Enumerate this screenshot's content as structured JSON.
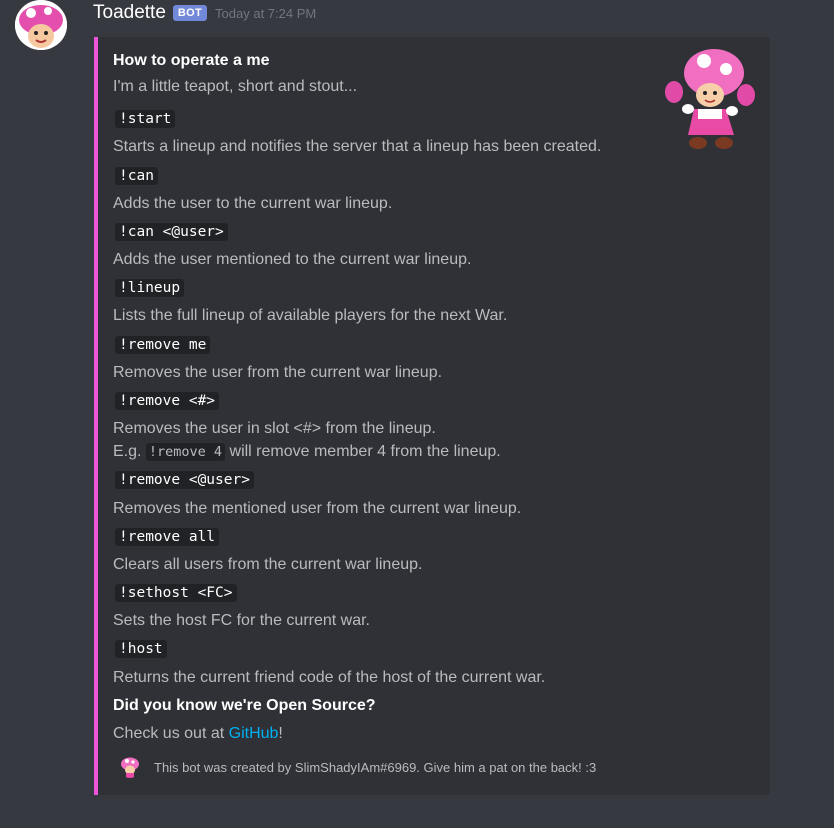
{
  "message": {
    "author": "Toadette",
    "bot_tag": "BOT",
    "timestamp": "Today at 7:24 PM"
  },
  "embed": {
    "accent_color": "#ee55d8",
    "title": "How to operate a me",
    "description": "I'm a little teapot, short and stout...",
    "commands": [
      {
        "cmd": "!start",
        "desc": "Starts a lineup and notifies the server that a lineup has been created."
      },
      {
        "cmd": "!can",
        "desc": "Adds the user to the current war lineup."
      },
      {
        "cmd": "!can <@user>",
        "desc": "Adds the user mentioned to the current war lineup."
      },
      {
        "cmd": "!lineup",
        "desc": "Lists the full lineup of available players for the next War."
      },
      {
        "cmd": "!remove me",
        "desc": "Removes the user from the current war lineup."
      },
      {
        "cmd": "!remove <#>",
        "desc": "Removes the user in slot <#> from the lineup.",
        "example_prefix": "E.g. ",
        "example_code": "!remove 4",
        "example_suffix": " will remove member 4 from the lineup."
      },
      {
        "cmd": "!remove <@user>",
        "desc": "Removes the mentioned user from the current war lineup."
      },
      {
        "cmd": "!remove all",
        "desc": "Clears all users from the current war lineup."
      },
      {
        "cmd": "!sethost <FC>",
        "desc": "Sets the host FC for the current war."
      },
      {
        "cmd": "!host",
        "desc": "Returns the current friend code of the host of the current war."
      }
    ],
    "open_source": {
      "name": "Did you know we're Open Source?",
      "text_prefix": "Check us out at ",
      "link": "GitHub",
      "text_suffix": "!"
    },
    "footer": "This bot was created by SlimShadyIAm#6969. Give him a pat on the back! :3"
  },
  "colors": {
    "background": "#36393f",
    "embed_bg": "#2f3136",
    "link": "#00b0f4",
    "bot_tag": "#7289da"
  },
  "icons": {
    "avatar": "toadette-avatar-icon",
    "thumbnail": "toadette-thumbnail-image",
    "footer": "toadette-footer-icon"
  }
}
